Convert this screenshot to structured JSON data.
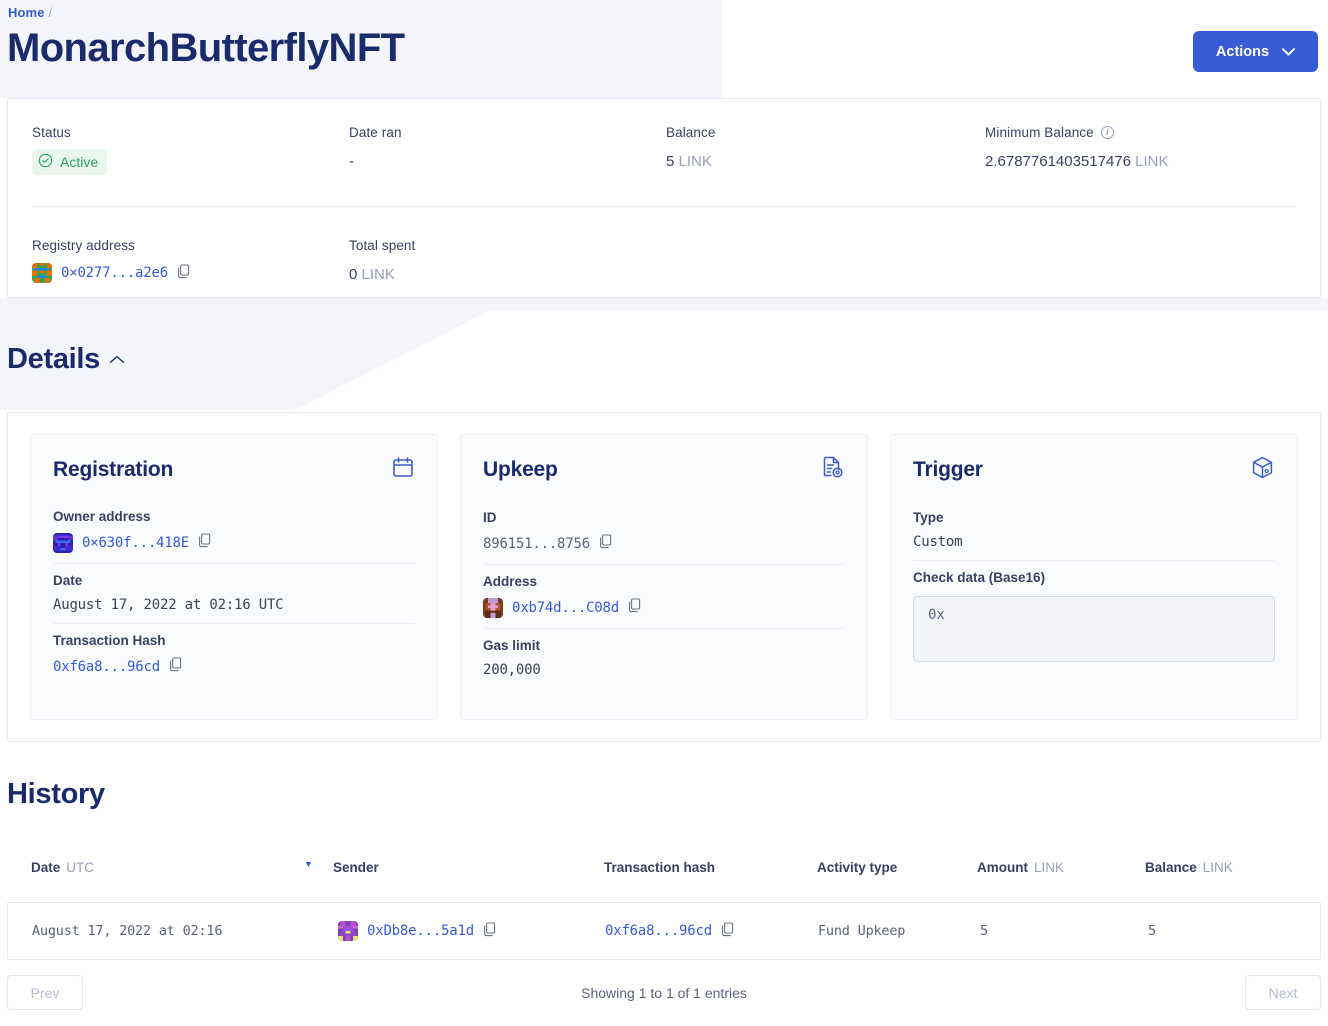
{
  "header": {
    "breadcrumb_home": "Home",
    "breadcrumb_separator": "/",
    "title": "MonarchButterflyNFT",
    "actions_label": "Actions"
  },
  "summary": {
    "status_label": "Status",
    "status_value": "Active",
    "date_ran_label": "Date ran",
    "date_ran_value": "-",
    "balance_label": "Balance",
    "balance_value": "5",
    "balance_unit": "LINK",
    "minimum_balance_label": "Minimum Balance",
    "minimum_balance_value": "2.6787761403517476",
    "minimum_balance_unit": "LINK",
    "registry_address_label": "Registry address",
    "registry_address_value": "0×0277...a2e6",
    "total_spent_label": "Total spent",
    "total_spent_value": "0",
    "total_spent_unit": "LINK"
  },
  "details": {
    "section_title": "Details",
    "registration": {
      "title": "Registration",
      "owner_label": "Owner address",
      "owner_value": "0×630f...418E",
      "date_label": "Date",
      "date_value": "August 17, 2022 at 02:16 UTC",
      "tx_label": "Transaction Hash",
      "tx_value": "0xf6a8...96cd"
    },
    "upkeep": {
      "title": "Upkeep",
      "id_label": "ID",
      "id_value": "896151...8756",
      "address_label": "Address",
      "address_value": "0xb74d...C08d",
      "gas_label": "Gas limit",
      "gas_value": "200,000"
    },
    "trigger": {
      "title": "Trigger",
      "type_label": "Type",
      "type_value": "Custom",
      "checkdata_label": "Check data (Base16)",
      "checkdata_value": "0x"
    }
  },
  "history": {
    "title": "History",
    "columns": {
      "date": "Date",
      "date_sub": "UTC",
      "sender": "Sender",
      "tx_hash": "Transaction hash",
      "activity_type": "Activity type",
      "amount": "Amount",
      "amount_sub": "LINK",
      "balance": "Balance",
      "balance_sub": "LINK"
    },
    "rows": [
      {
        "date": "August 17, 2022 at 02:16",
        "sender": "0xDb8e...5a1d",
        "tx_hash": "0xf6a8...96cd",
        "activity_type": "Fund Upkeep",
        "amount": "5",
        "balance": "5"
      }
    ]
  },
  "pagination": {
    "prev": "Prev",
    "next": "Next",
    "info": "Showing 1 to 1 of 1 entries"
  },
  "colors": {
    "brand_blue": "#375bd2",
    "title_navy": "#1a2b6b",
    "status_green": "#29a35a",
    "status_green_bg": "#eaf7ef",
    "page_bg_tint": "#f4f5fb"
  }
}
